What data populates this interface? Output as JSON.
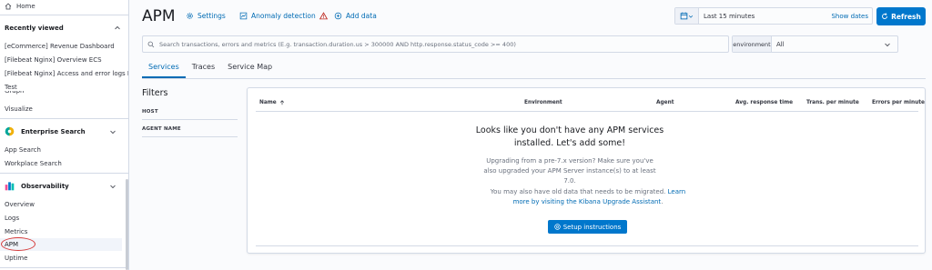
{
  "sidebar": {
    "home_label": "Home",
    "recently_viewed": {
      "title": "Recently viewed",
      "items": [
        "[eCommerce] Revenue Dashboard",
        "[Filebeat Nginx] Overview ECS",
        "[Filebeat Nginx] Access and error logs ECS",
        "Test"
      ]
    },
    "cut_item": "Graph",
    "visualize_label": "Visualize",
    "enterprise_search": {
      "title": "Enterprise Search",
      "items": [
        "App Search",
        "Workplace Search"
      ]
    },
    "observability": {
      "title": "Observability",
      "items": [
        "Overview",
        "Logs",
        "Metrics",
        "APM",
        "Uptime"
      ]
    }
  },
  "header": {
    "title": "APM",
    "settings_label": "Settings",
    "anomaly_label": "Anomaly detection",
    "add_data_label": "Add data",
    "date_range": "Last 15 minutes",
    "show_dates_label": "Show dates",
    "refresh_label": "Refresh"
  },
  "search": {
    "placeholder": "Search transactions, errors and metrics (E.g. transaction.duration.us > 300000 AND http.response.status_code >= 400)",
    "environment_label": "environment",
    "environment_value": "All"
  },
  "tabs": [
    "Services",
    "Traces",
    "Service Map"
  ],
  "filters": {
    "title": "Filters",
    "items": [
      "HOST",
      "AGENT NAME"
    ]
  },
  "table": {
    "columns": [
      "Name",
      "Environment",
      "Agent",
      "Avg. response time",
      "Trans. per minute",
      "Errors per minute"
    ],
    "empty_title": "Looks like you don't have any APM services installed. Let's add some!",
    "upgrade_text": "Upgrading from a pre-7.x version? Make sure you've also upgraded your APM Server instance(s) to at least 7.0.",
    "migrate_text": "You may also have old data that needs to be migrated.",
    "migrate_link": "Learn more by visiting the Kibana Upgrade Assistant",
    "setup_label": "Setup instructions"
  },
  "colors": {
    "primary": "#0077cc",
    "link": "#006bb4",
    "danger": "#bd271e"
  }
}
